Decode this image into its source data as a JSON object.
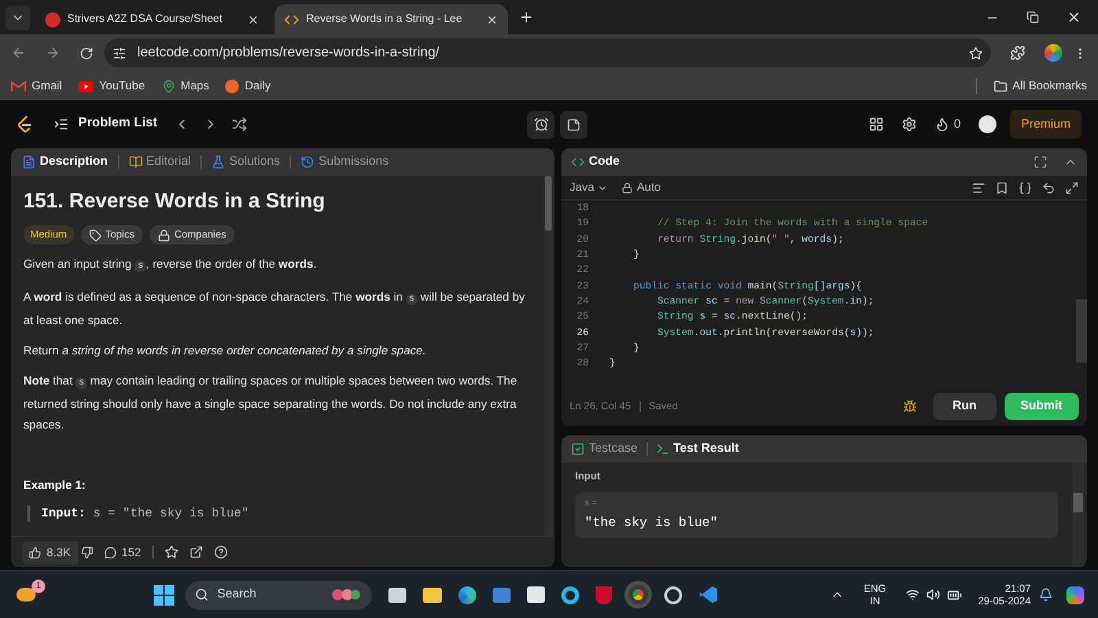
{
  "browser": {
    "tabs": [
      {
        "title": "Strivers A2Z DSA Course/Sheet",
        "kind": "tuf",
        "selected": false
      },
      {
        "title": "Reverse Words in a String - Lee",
        "kind": "leetcode",
        "selected": true
      }
    ],
    "url": "leetcode.com/problems/reverse-words-in-a-string/",
    "bookmarks": [
      {
        "label": "Gmail",
        "kind": "gmail"
      },
      {
        "label": "YouTube",
        "kind": "youtube"
      },
      {
        "label": "Maps",
        "kind": "maps"
      },
      {
        "label": "Daily",
        "kind": "daily"
      }
    ],
    "all_bookmarks": "All Bookmarks"
  },
  "header": {
    "problem_list": "Problem List",
    "streak": "0",
    "premium": "Premium"
  },
  "description": {
    "tabs": [
      {
        "label": "Description",
        "kind": "description",
        "selected": true
      },
      {
        "label": "Editorial",
        "kind": "editorial",
        "selected": false
      },
      {
        "label": "Solutions",
        "kind": "solutions",
        "selected": false
      },
      {
        "label": "Submissions",
        "kind": "submissions",
        "selected": false
      }
    ],
    "title": "151. Reverse Words in a String",
    "difficulty": "Medium",
    "tags": [
      {
        "label": "Topics",
        "kind": "topics"
      },
      {
        "label": "Companies",
        "kind": "companies"
      }
    ],
    "paragraphs": [
      [
        {
          "kind": "text",
          "text": "Given an input string "
        },
        {
          "kind": "code",
          "text": "s"
        },
        {
          "kind": "text",
          "text": ", reverse the order of the **words**."
        }
      ],
      [
        {
          "kind": "text",
          "text": "A **word** is defined as a sequence of non-space characters. The **words** in "
        },
        {
          "kind": "code",
          "text": "s"
        },
        {
          "kind": "text",
          "text": " will be separated by at least one space."
        }
      ],
      [
        {
          "kind": "text",
          "text": "Return *a string of the words in reverse order concatenated by a single space.*"
        }
      ],
      [
        {
          "kind": "text",
          "text": "**Note** that "
        },
        {
          "kind": "code",
          "text": "s"
        },
        {
          "kind": "text",
          "text": " may contain leading or trailing spaces or multiple spaces between two words. The returned string should only have a single space separating the words. Do not include any extra spaces."
        }
      ]
    ],
    "example_title": "Example 1:",
    "example_label": "Input:",
    "example_value": "s = \"the sky is blue\"",
    "likes": "8.3K",
    "comments": "152"
  },
  "code": {
    "title": "Code",
    "language": "Java",
    "mode": "Auto",
    "lines": [
      {
        "number": "18",
        "current": false
      },
      {
        "number": "19",
        "current": false,
        "tokens": [
          {
            "kind": "comment",
            "text": "        // Step 4: Join the words with a single space"
          }
        ]
      },
      {
        "number": "20",
        "current": false,
        "tokens": [
          {
            "kind": "control",
            "text": "        return "
          },
          {
            "kind": "type",
            "text": "String"
          },
          {
            "kind": "plain",
            "text": "."
          },
          {
            "kind": "method",
            "text": "join"
          },
          {
            "kind": "plain",
            "text": "("
          },
          {
            "kind": "string",
            "text": "\" \""
          },
          {
            "kind": "plain",
            "text": ", "
          },
          {
            "kind": "variable",
            "text": "words"
          },
          {
            "kind": "plain",
            "text": ");"
          }
        ]
      },
      {
        "number": "21",
        "current": false,
        "tokens": [
          {
            "kind": "plain",
            "text": "    }"
          }
        ]
      },
      {
        "number": "22",
        "current": false
      },
      {
        "number": "23",
        "current": false,
        "tokens": [
          {
            "kind": "keyword",
            "text": "    public "
          },
          {
            "kind": "keyword",
            "text": "static "
          },
          {
            "kind": "keyword",
            "text": "void "
          },
          {
            "kind": "method",
            "text": "main"
          },
          {
            "kind": "plain",
            "text": "("
          },
          {
            "kind": "type",
            "text": "String"
          },
          {
            "kind": "plain",
            "text": "[]"
          },
          {
            "kind": "variable",
            "text": "args"
          },
          {
            "kind": "plain",
            "text": "){"
          }
        ]
      },
      {
        "number": "24",
        "current": false,
        "tokens": [
          {
            "kind": "type",
            "text": "        Scanner "
          },
          {
            "kind": "variable",
            "text": "sc"
          },
          {
            "kind": "plain",
            "text": " = "
          },
          {
            "kind": "control",
            "text": "new "
          },
          {
            "kind": "type",
            "text": "Scanner"
          },
          {
            "kind": "plain",
            "text": "("
          },
          {
            "kind": "type",
            "text": "System"
          },
          {
            "kind": "plain",
            "text": "."
          },
          {
            "kind": "variable",
            "text": "in"
          },
          {
            "kind": "plain",
            "text": ");"
          }
        ]
      },
      {
        "number": "25",
        "current": false,
        "tokens": [
          {
            "kind": "type",
            "text": "        String "
          },
          {
            "kind": "variable",
            "text": "s"
          },
          {
            "kind": "plain",
            "text": " = "
          },
          {
            "kind": "variable",
            "text": "sc"
          },
          {
            "kind": "plain",
            "text": "."
          },
          {
            "kind": "method",
            "text": "nextLine"
          },
          {
            "kind": "plain",
            "text": "();"
          }
        ]
      },
      {
        "number": "26",
        "current": true,
        "tokens": [
          {
            "kind": "type",
            "text": "        System"
          },
          {
            "kind": "plain",
            "text": "."
          },
          {
            "kind": "variable",
            "text": "out"
          },
          {
            "kind": "plain",
            "text": "."
          },
          {
            "kind": "method",
            "text": "println"
          },
          {
            "kind": "plain",
            "text": "("
          },
          {
            "kind": "method",
            "text": "reverseWords"
          },
          {
            "kind": "plain",
            "text": "("
          },
          {
            "kind": "variable",
            "text": "s"
          },
          {
            "kind": "plain",
            "text": "));"
          }
        ]
      },
      {
        "number": "27",
        "current": false,
        "tokens": [
          {
            "kind": "plain",
            "text": "    }"
          }
        ]
      },
      {
        "number": "28",
        "current": false,
        "tokens": [
          {
            "kind": "plain",
            "text": "}"
          }
        ]
      }
    ],
    "cursor": "Ln 26, Col 45",
    "save_status": "Saved",
    "run": "Run",
    "submit": "Submit"
  },
  "testcase": {
    "tabs": [
      {
        "label": "Testcase",
        "kind": "testcase",
        "selected": false
      },
      {
        "label": "Test Result",
        "kind": "result",
        "selected": true
      }
    ],
    "input_label": "Input",
    "variable": "s =",
    "value": "\"the sky is blue\""
  },
  "taskbar": {
    "weather_badge": "1",
    "search": "Search",
    "language": "ENG",
    "region": "IN",
    "time": "21:07",
    "date": "29-05-2024"
  }
}
